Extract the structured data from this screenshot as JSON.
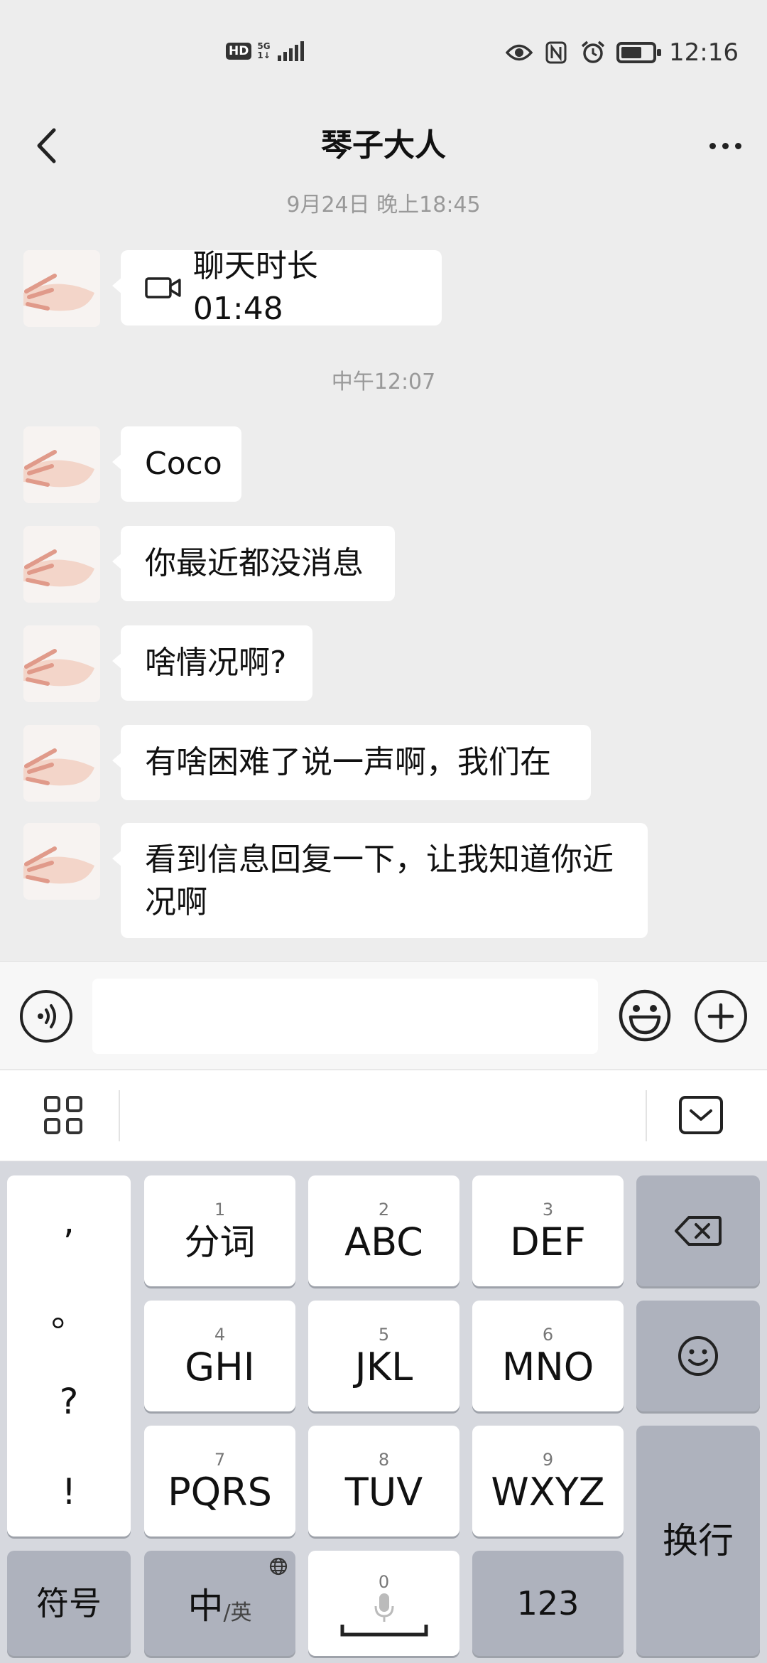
{
  "status_bar": {
    "hd": "HD",
    "network_top": "5G",
    "network_bottom": "1↓",
    "time": "12:16"
  },
  "nav": {
    "title": "琴子大人",
    "back_icon": "chevron-left-icon",
    "more_icon": "more-dots-icon"
  },
  "messages": {
    "ts1": "9月24日 晚上18:45",
    "call_text": "聊天时长 01:48",
    "ts2": "中午12:07",
    "m1": "Coco",
    "m2": "你最近都没消息",
    "m3": "啥情况啊?",
    "m4": "有啥困难了说一声啊，我们在",
    "m5_line1": "看到信息回复一下，让我知道你近",
    "m5_line2": "况啊"
  },
  "input": {
    "value": "",
    "placeholder": ""
  },
  "keyboard": {
    "punct": [
      ",",
      "。",
      "?",
      "!"
    ],
    "keys": [
      {
        "num": "1",
        "label": "分词"
      },
      {
        "num": "2",
        "label": "ABC"
      },
      {
        "num": "3",
        "label": "DEF"
      },
      {
        "num": "4",
        "label": "GHI"
      },
      {
        "num": "5",
        "label": "JKL"
      },
      {
        "num": "6",
        "label": "MNO"
      },
      {
        "num": "7",
        "label": "PQRS"
      },
      {
        "num": "8",
        "label": "TUV"
      },
      {
        "num": "9",
        "label": "WXYZ"
      }
    ],
    "symbol_key": "符号",
    "lang_main": "中",
    "lang_sub": "/英",
    "space_num": "0",
    "num_key": "123",
    "enter_key": "换行"
  },
  "colors": {
    "background": "#ededed",
    "bubble": "#ffffff",
    "keyboard_bg": "#d6d8de",
    "function_key": "#aeb2bd"
  }
}
